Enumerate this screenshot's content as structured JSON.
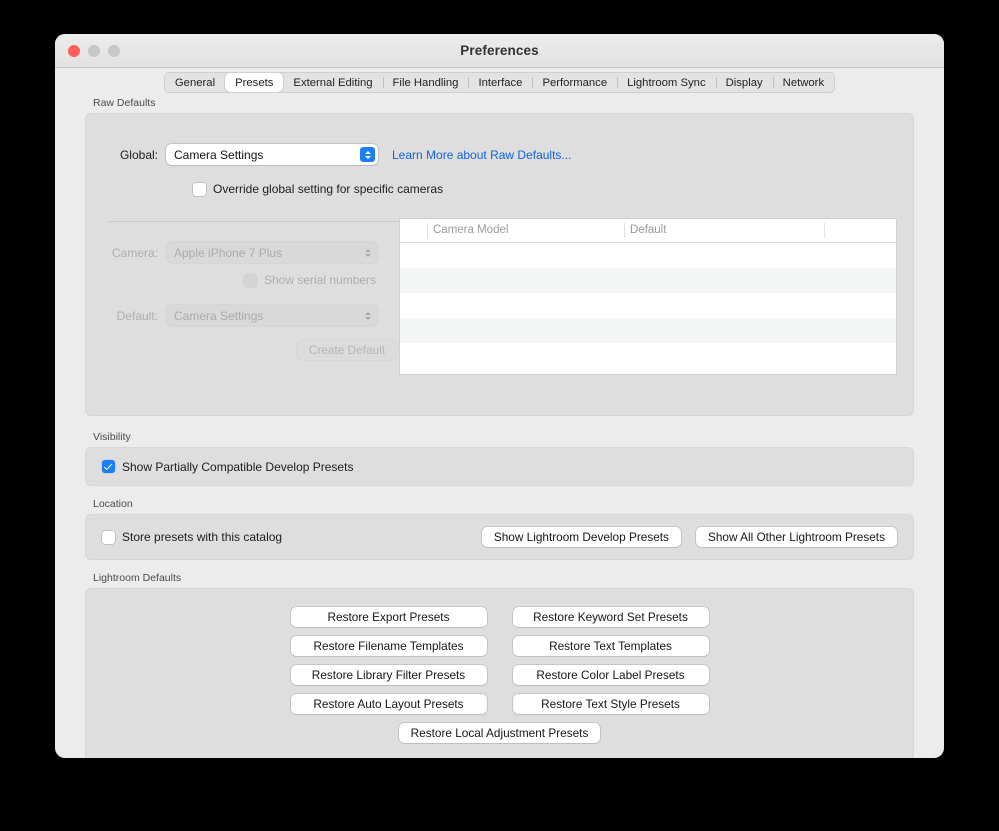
{
  "window": {
    "title": "Preferences",
    "traffic_lights": [
      "close",
      "minimize",
      "maximize"
    ]
  },
  "tabs": [
    {
      "label": "General",
      "active": false
    },
    {
      "label": "Presets",
      "active": true
    },
    {
      "label": "External Editing",
      "active": false
    },
    {
      "label": "File Handling",
      "active": false
    },
    {
      "label": "Interface",
      "active": false
    },
    {
      "label": "Performance",
      "active": false
    },
    {
      "label": "Lightroom Sync",
      "active": false
    },
    {
      "label": "Display",
      "active": false
    },
    {
      "label": "Network",
      "active": false
    }
  ],
  "raw_defaults": {
    "group_label": "Raw Defaults",
    "global_label": "Global:",
    "global_value": "Camera Settings",
    "learn_more_link": "Learn More about Raw Defaults...",
    "override_checkbox_label": "Override global setting for specific cameras",
    "override_checked": false,
    "camera_label": "Camera:",
    "camera_value": "Apple iPhone 7 Plus",
    "show_serial_label": "Show serial numbers",
    "show_serial_checked": false,
    "default_label": "Default:",
    "default_value": "Camera Settings",
    "create_default_button": "Create Default",
    "table": {
      "columns": [
        "Camera Model",
        "Default",
        ""
      ],
      "rows": []
    }
  },
  "visibility": {
    "group_label": "Visibility",
    "checkbox_label": "Show Partially Compatible Develop Presets",
    "checked": true
  },
  "location": {
    "group_label": "Location",
    "checkbox_label": "Store presets with this catalog",
    "checked": false,
    "buttons": [
      "Show Lightroom Develop Presets",
      "Show All Other Lightroom Presets"
    ]
  },
  "lightroom_defaults": {
    "group_label": "Lightroom Defaults",
    "rows": [
      [
        "Restore Export Presets",
        "Restore Keyword Set Presets"
      ],
      [
        "Restore Filename Templates",
        "Restore Text Templates"
      ],
      [
        "Restore Library Filter Presets",
        "Restore Color Label Presets"
      ],
      [
        "Restore Auto Layout Presets",
        "Restore Text Style Presets"
      ]
    ],
    "last_button": "Restore Local Adjustment Presets"
  },
  "colors": {
    "accent": "#1b80f5",
    "link": "#1164dd",
    "window_bg": "#ececec",
    "panel_bg": "#dedede",
    "close_red": "#ff6159"
  }
}
